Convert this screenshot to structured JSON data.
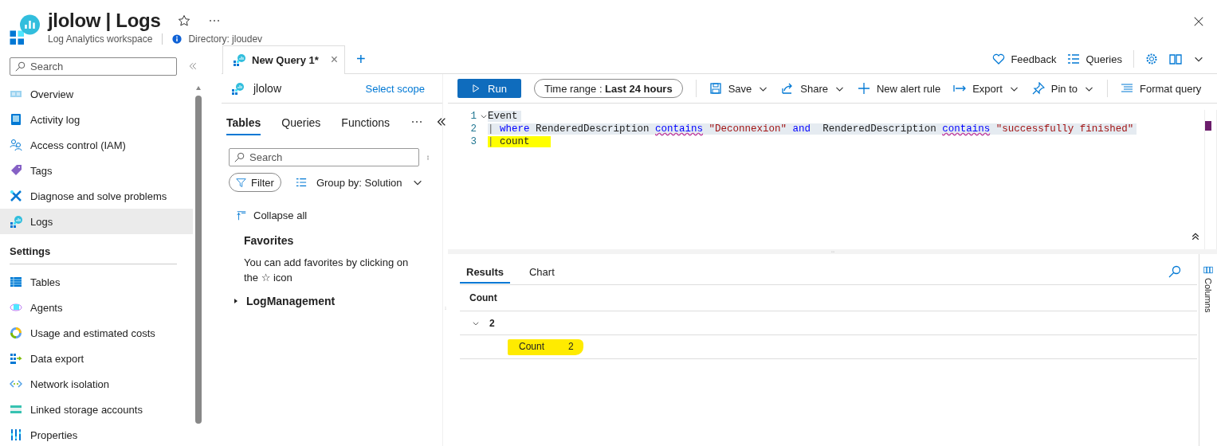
{
  "header": {
    "title": "jlolow | Logs",
    "subtitle": "Log Analytics workspace",
    "directory": "Directory: jloudev"
  },
  "sidebar": {
    "search_placeholder": "Search",
    "items": [
      {
        "kind": "item",
        "label": "Overview",
        "selected": false
      },
      {
        "kind": "item",
        "label": "Activity log",
        "selected": false
      },
      {
        "kind": "item",
        "label": "Access control (IAM)",
        "selected": false
      },
      {
        "kind": "item",
        "label": "Tags",
        "selected": false
      },
      {
        "kind": "item",
        "label": "Diagnose and solve problems",
        "selected": false
      },
      {
        "kind": "item",
        "label": "Logs",
        "selected": true
      },
      {
        "kind": "heading",
        "label": "Settings"
      },
      {
        "kind": "item",
        "label": "Tables",
        "selected": false
      },
      {
        "kind": "item",
        "label": "Agents",
        "selected": false
      },
      {
        "kind": "item",
        "label": "Usage and estimated costs",
        "selected": false
      },
      {
        "kind": "item",
        "label": "Data export",
        "selected": false
      },
      {
        "kind": "item",
        "label": "Network isolation",
        "selected": false
      },
      {
        "kind": "item",
        "label": "Linked storage accounts",
        "selected": false
      },
      {
        "kind": "item",
        "label": "Properties",
        "selected": false
      }
    ]
  },
  "query_tab": {
    "label": "New Query 1*",
    "close": "×",
    "add": "+"
  },
  "top_actions": [
    {
      "label": "Feedback"
    },
    {
      "label": "Queries"
    }
  ],
  "scope": {
    "name": "jlolow",
    "link": "Select scope"
  },
  "toolbar": {
    "run": "Run",
    "time_range_label": "Time range :",
    "time_range_value": "Last 24 hours",
    "actions": [
      {
        "label": "Save",
        "dropdown": true
      },
      {
        "label": "Share",
        "dropdown": true
      },
      {
        "label": "New alert rule",
        "dropdown": false
      },
      {
        "label": "Export",
        "dropdown": true
      },
      {
        "label": "Pin to",
        "dropdown": true
      },
      {
        "label": "Format query",
        "dropdown": false
      }
    ]
  },
  "schema_panel": {
    "tabs": [
      {
        "label": "Tables",
        "selected": true
      },
      {
        "label": "Queries",
        "selected": false
      },
      {
        "label": "Functions",
        "selected": false
      }
    ],
    "search_placeholder": "Search",
    "filter": "Filter",
    "group_by": "Group by: Solution",
    "collapse_all": "Collapse all",
    "favorites_title": "Favorites",
    "favorites_text": "You can add favorites by clicking on the ☆ icon",
    "tree": [
      {
        "label": "LogManagement",
        "expanded": false
      }
    ]
  },
  "editor": {
    "lines": [
      {
        "number": "1",
        "selected": true,
        "highlighted": false,
        "tokens": [
          {
            "kind": "plain",
            "text": "Event"
          }
        ]
      },
      {
        "number": "2",
        "selected": true,
        "highlighted": false,
        "tokens": [
          {
            "kind": "pipe",
            "text": "| "
          },
          {
            "kind": "keyword",
            "text": "where"
          },
          {
            "kind": "plain",
            "text": " RenderedDescription "
          },
          {
            "kind": "function",
            "text": "contains"
          },
          {
            "kind": "string",
            "text": " \"Deconnexion\" "
          },
          {
            "kind": "keyword",
            "text": "and"
          },
          {
            "kind": "plain",
            "text": "  RenderedDescription "
          },
          {
            "kind": "function",
            "text": "contains"
          },
          {
            "kind": "string",
            "text": " \"successfully finished\""
          }
        ]
      },
      {
        "number": "3",
        "selected": false,
        "highlighted": true,
        "tokens": [
          {
            "kind": "pipe",
            "text": "| "
          },
          {
            "kind": "plain",
            "text": "count"
          }
        ]
      }
    ]
  },
  "results": {
    "tabs": [
      {
        "label": "Results",
        "selected": true
      },
      {
        "label": "Chart",
        "selected": false
      }
    ],
    "columns": [
      "Count"
    ],
    "rows": [
      {
        "value": "2",
        "expanded": true,
        "detail_label": "Count",
        "detail_value": "2",
        "highlighted": true
      }
    ],
    "columns_button": "Columns"
  }
}
